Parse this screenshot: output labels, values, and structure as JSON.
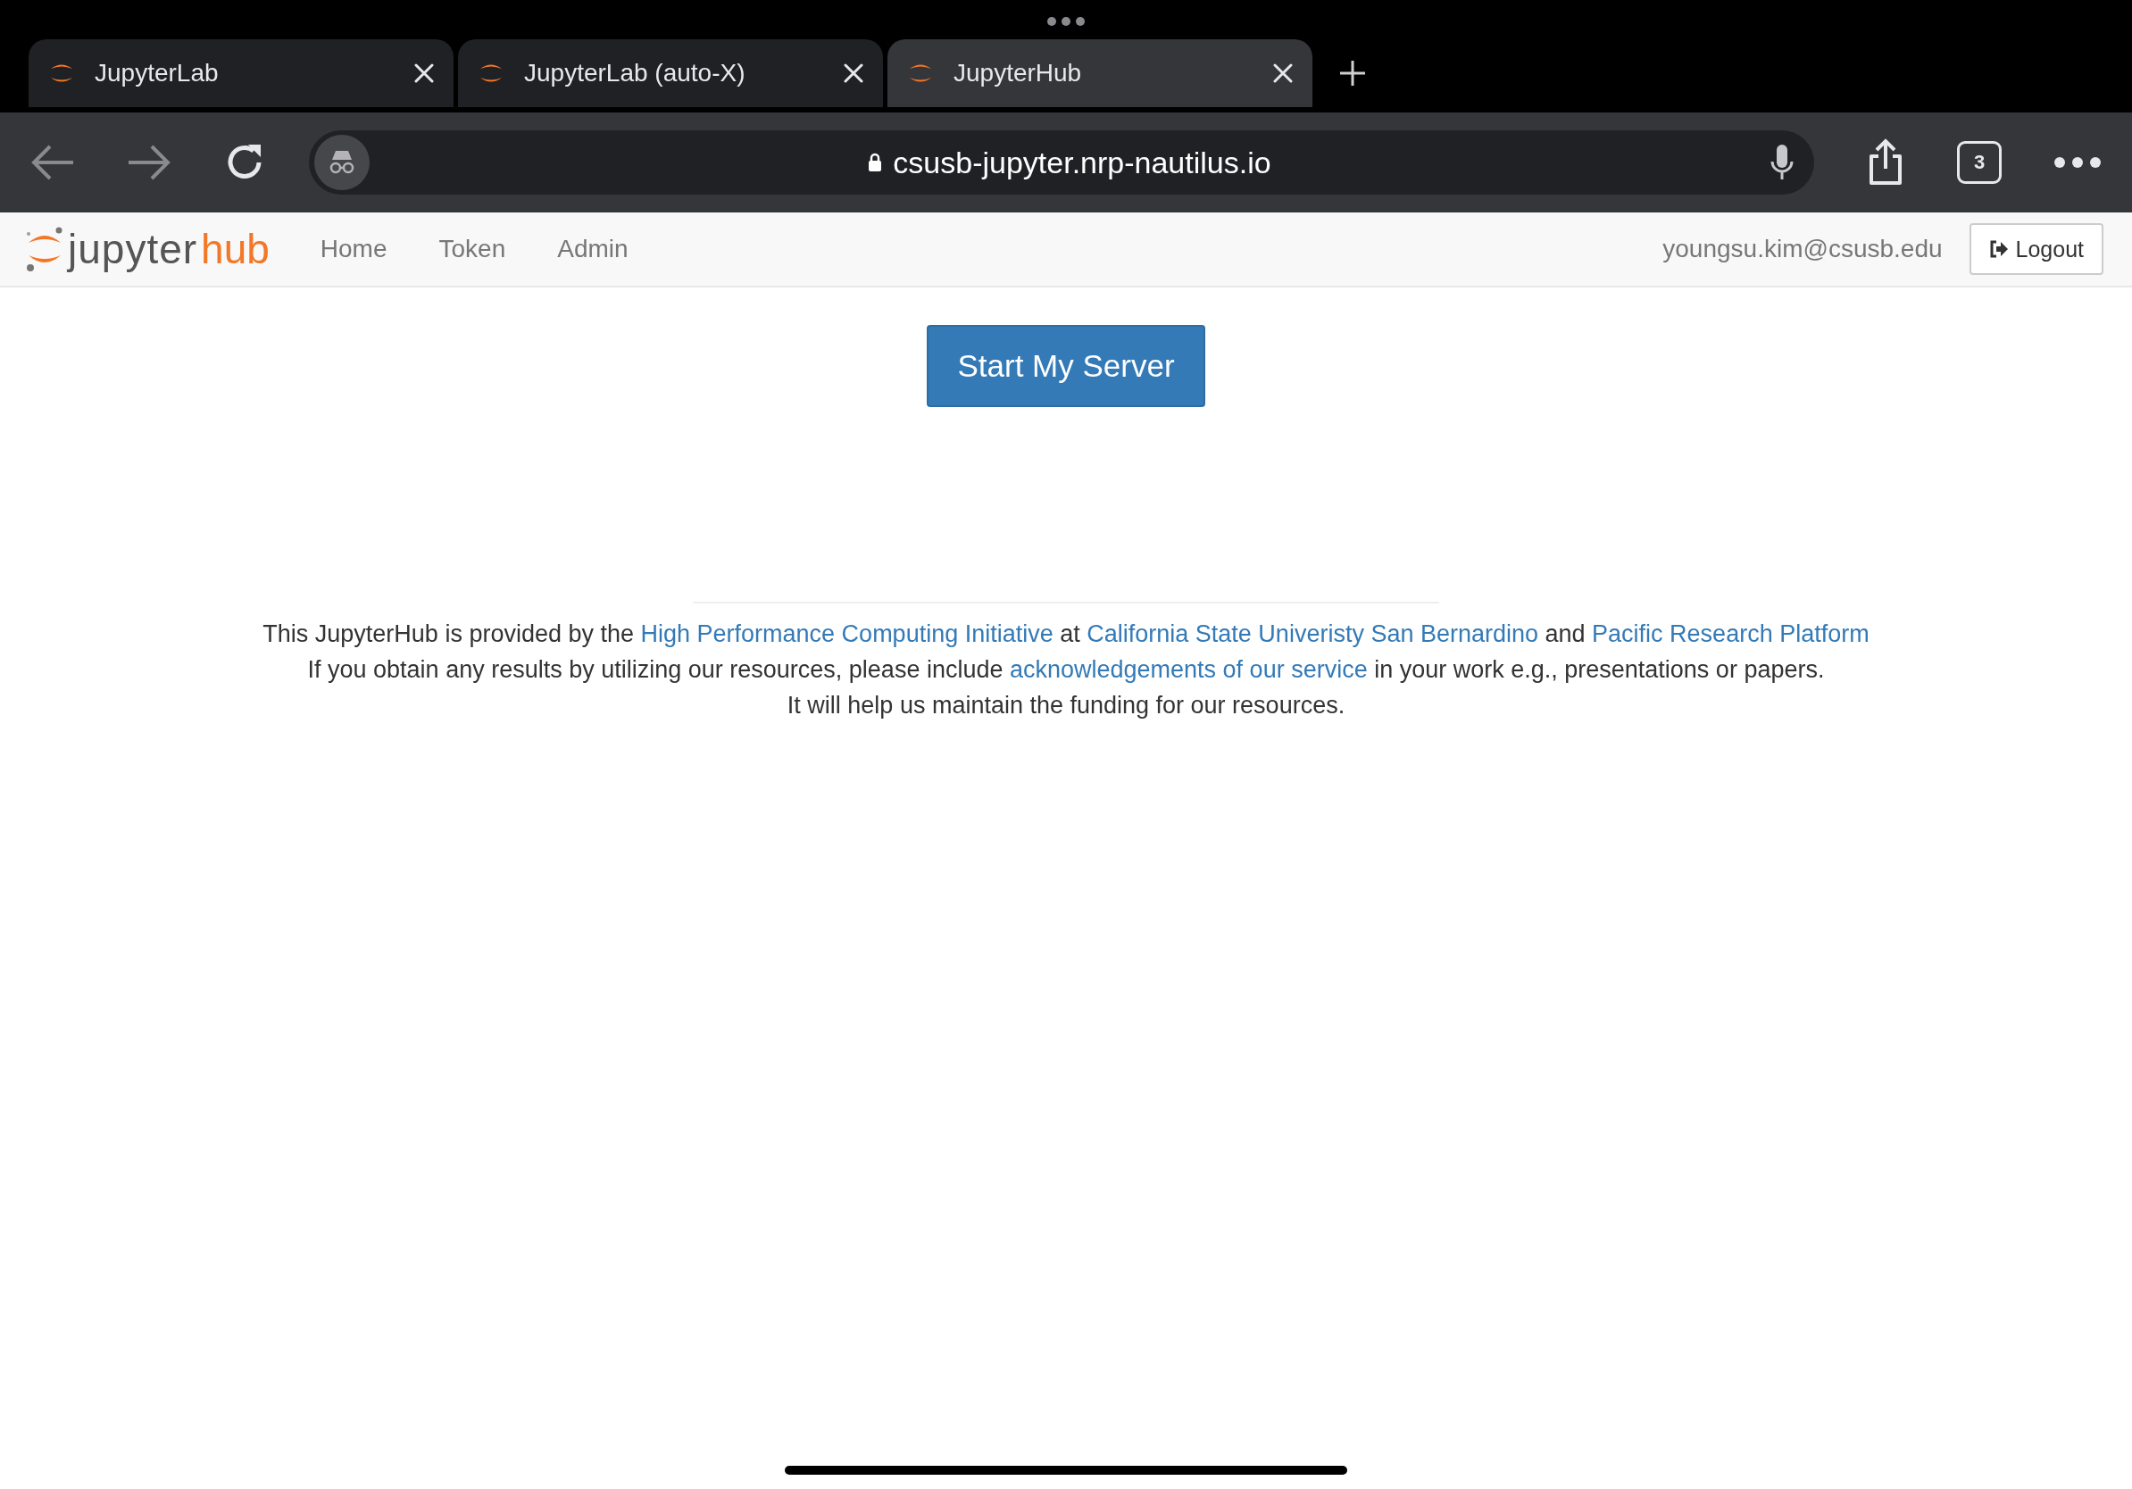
{
  "tabs": [
    {
      "title": "JupyterLab",
      "selected": false
    },
    {
      "title": "JupyterLab (auto-X)",
      "selected": false
    },
    {
      "title": "JupyterHub",
      "selected": true
    }
  ],
  "toolbar": {
    "back_disabled": true,
    "forward_disabled": true,
    "url": "csusb-jupyter.nrp-nautilus.io",
    "tab_count": "3"
  },
  "navbar": {
    "logo": {
      "text": "jupyter",
      "accent": "hub"
    },
    "links": [
      {
        "label": "Home"
      },
      {
        "label": "Token"
      },
      {
        "label": "Admin"
      }
    ],
    "user": "youngsu.kim@csusb.edu",
    "logout": "Logout"
  },
  "main": {
    "start_button": "Start My Server"
  },
  "footer": {
    "lines": [
      [
        {
          "kind": "text",
          "text": "This JupyterHub is provided by the "
        },
        {
          "kind": "link",
          "text": "High Performance Computing Initiative"
        },
        {
          "kind": "text",
          "text": " at "
        },
        {
          "kind": "link",
          "text": "California State Univeristy San Bernardino"
        },
        {
          "kind": "text",
          "text": " and "
        },
        {
          "kind": "link",
          "text": "Pacific Research Platform"
        }
      ],
      [
        {
          "kind": "text",
          "text": "If you obtain any results by utilizing our resources, please include "
        },
        {
          "kind": "link",
          "text": "acknowledgements of our service"
        },
        {
          "kind": "text",
          "text": " in your work e.g., presentations or papers."
        }
      ],
      [
        {
          "kind": "text",
          "text": "It will help us maintain the funding for our resources."
        }
      ]
    ]
  }
}
